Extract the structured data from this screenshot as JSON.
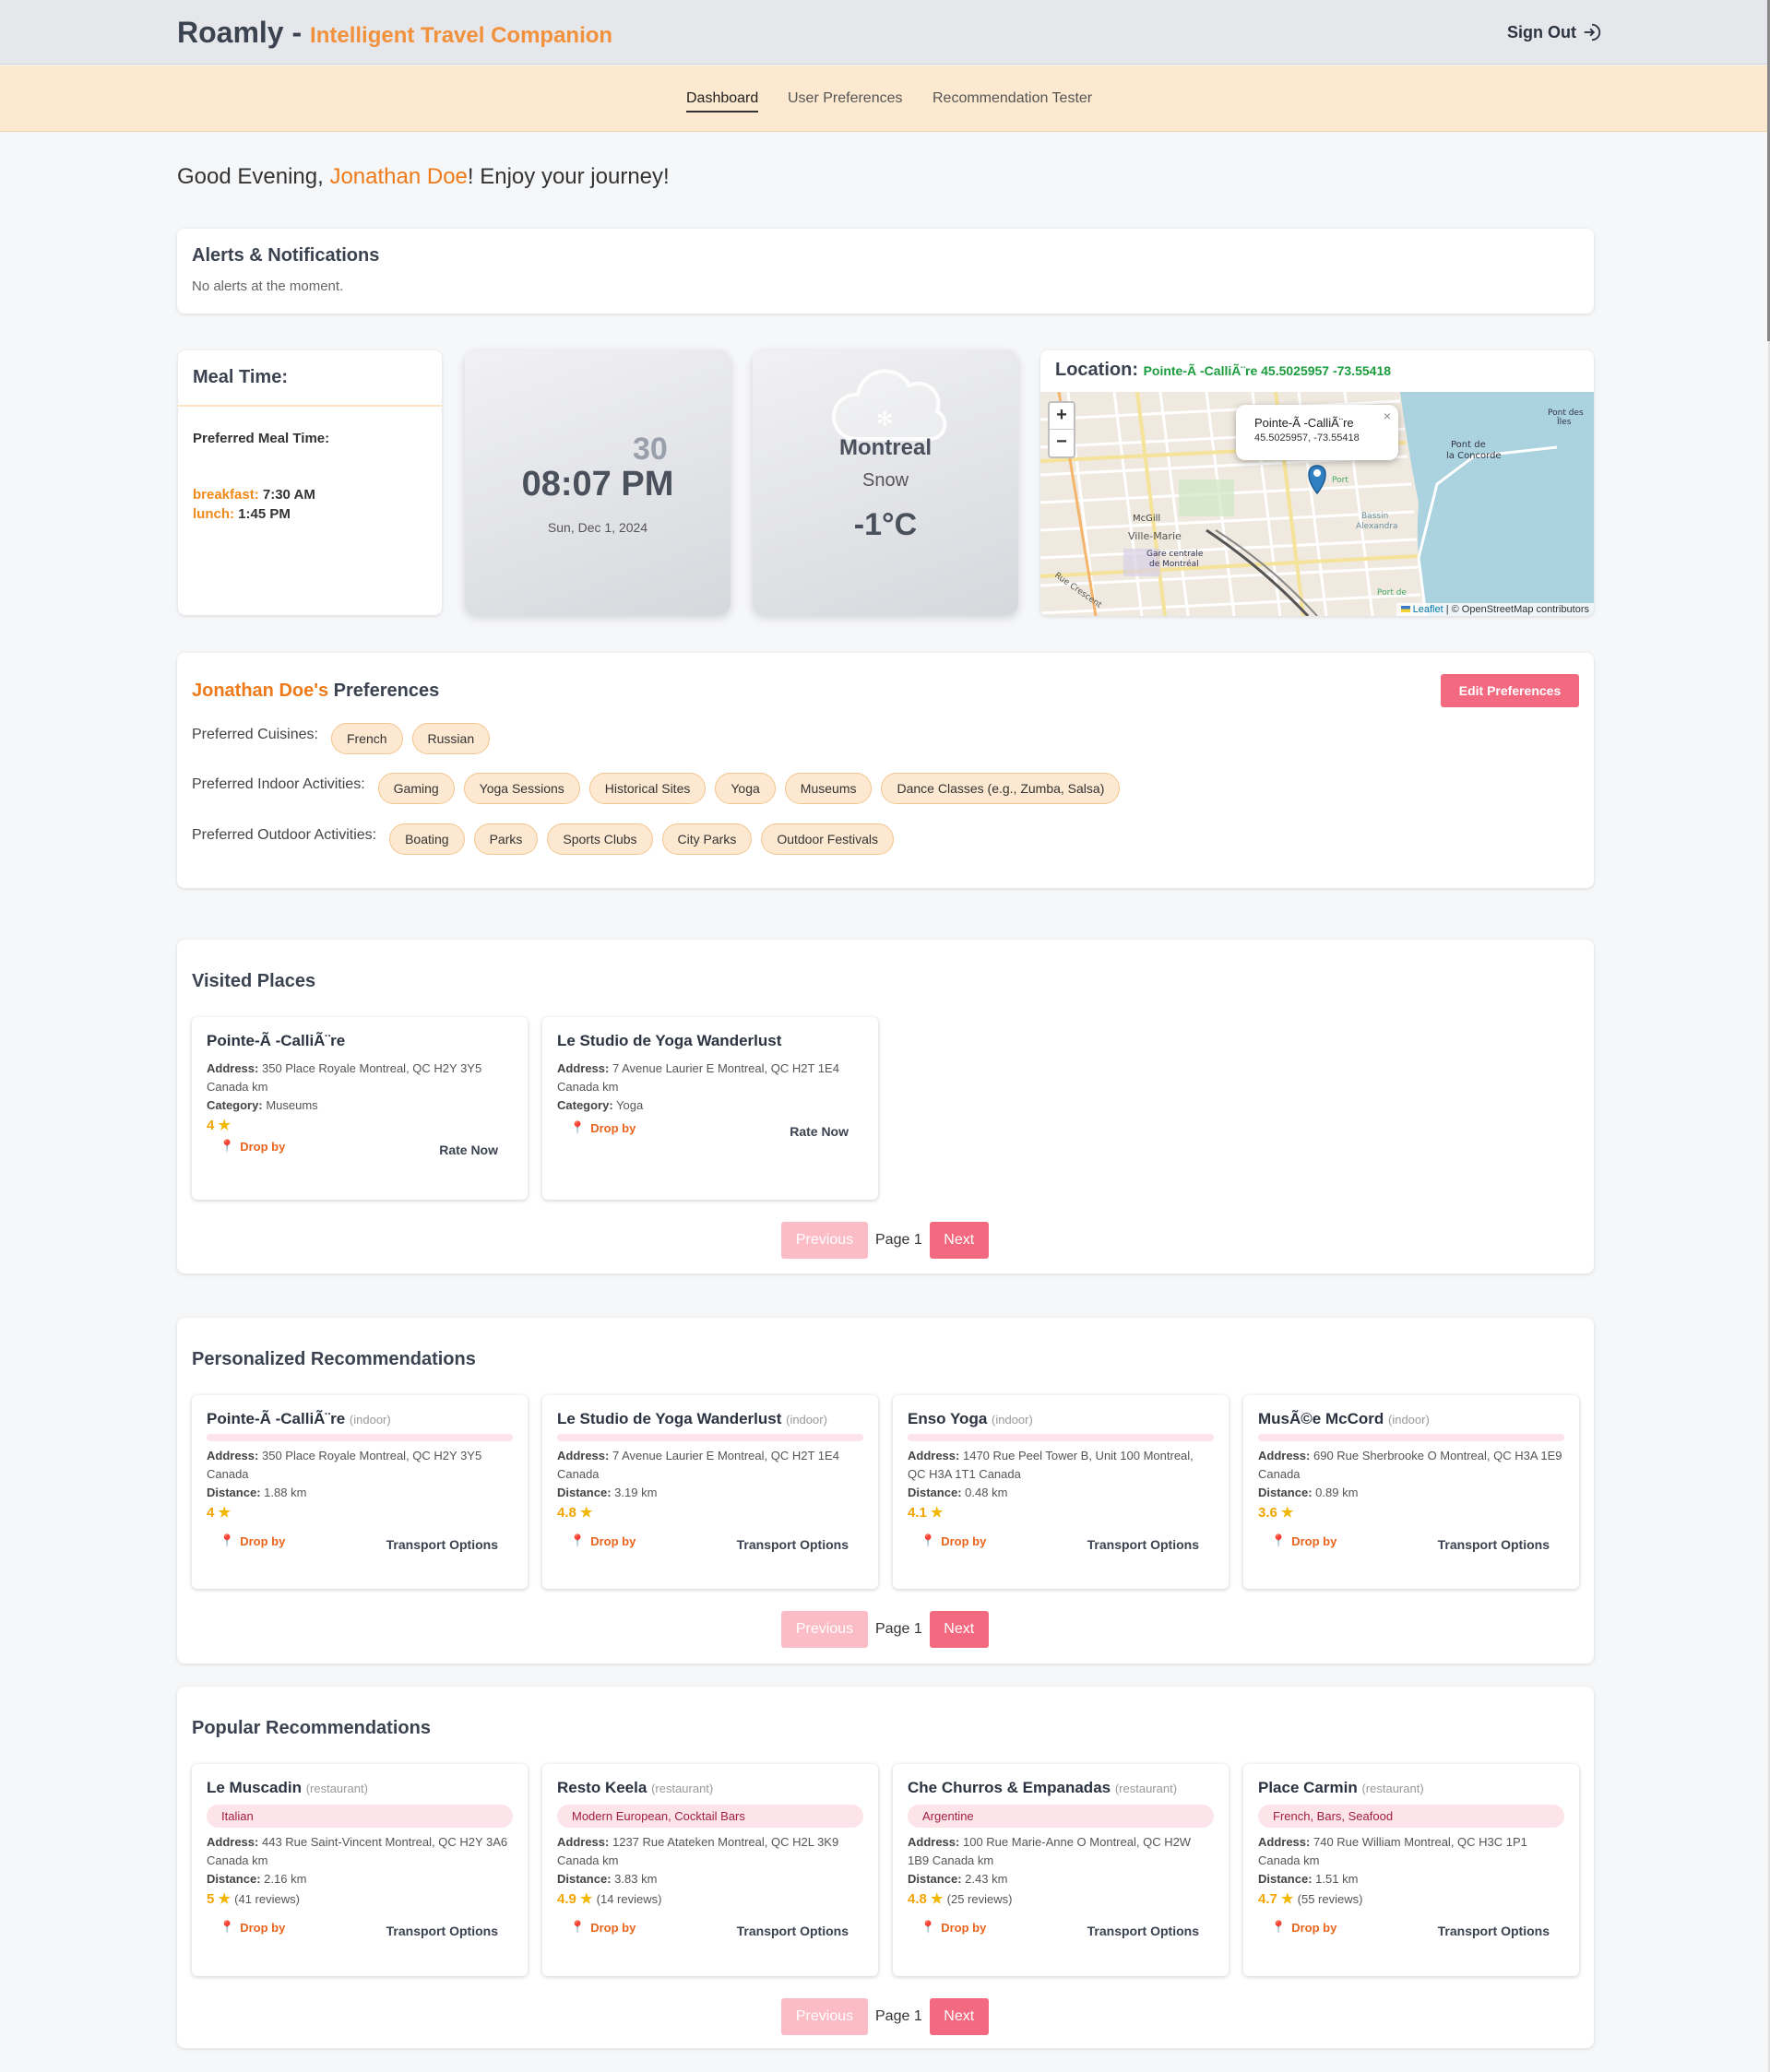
{
  "header": {
    "brand": "Roamly",
    "separator": "-",
    "tagline": "Intelligent Travel Companion",
    "signout": "Sign Out"
  },
  "nav": [
    {
      "label": "Dashboard",
      "active": true
    },
    {
      "label": "User Preferences",
      "active": false
    },
    {
      "label": "Recommendation Tester",
      "active": false
    }
  ],
  "greeting": {
    "prefix": "Good Evening, ",
    "name": "Jonathan Doe",
    "suffix": "! Enjoy your journey!"
  },
  "alerts": {
    "title": "Alerts & Notifications",
    "message": "No alerts at the moment."
  },
  "meal": {
    "title": "Meal Time:",
    "subtitle": "Preferred Meal Time:",
    "items": [
      {
        "key": "breakfast:",
        "value": "7:30 AM"
      },
      {
        "key": "lunch:",
        "value": "1:45 PM"
      }
    ]
  },
  "clock": {
    "seconds": "30",
    "time": "08:07 PM",
    "date": "Sun, Dec 1, 2024"
  },
  "weather": {
    "city": "Montreal",
    "condition": "Snow",
    "temp": "-1°C",
    "icon": "snow-cloud-icon"
  },
  "location": {
    "label": "Location:",
    "value": "Pointe-Ã -CalliÃ¨re 45.5025957 -73.55418",
    "popup_name": "Pointe-Ã -CalliÃ¨re",
    "popup_coords": "45.5025957, -73.55418",
    "zoom_in": "+",
    "zoom_out": "−",
    "attribution_leaflet": "Leaflet",
    "attribution_rest": "| © OpenStreetMap contributors",
    "map_labels": [
      "Gare centrale de Montréal",
      "Ville-Marie",
      "McGill",
      "Pont de la Concorde",
      "Port",
      "Bassin Alexandra",
      "Pont des Îles",
      "Rue Crescent",
      "Port de"
    ]
  },
  "preferences": {
    "name": "Jonathan Doe's",
    "title": " Preferences",
    "edit_button": "Edit Preferences",
    "cuisines_label": "Preferred Cuisines:",
    "cuisines": [
      "French",
      "Russian"
    ],
    "indoor_label": "Preferred Indoor Activities:",
    "indoor": [
      "Gaming",
      "Yoga Sessions",
      "Historical Sites",
      "Yoga",
      "Museums",
      "Dance Classes (e.g., Zumba, Salsa)"
    ],
    "outdoor_label": "Preferred Outdoor Activities:",
    "outdoor": [
      "Boating",
      "Parks",
      "Sports Clubs",
      "City Parks",
      "Outdoor Festivals"
    ]
  },
  "labels": {
    "address": "Address:",
    "category": "Category:",
    "distance": "Distance:",
    "drop_by": "Drop by",
    "rate_now": "Rate Now",
    "transport": "Transport Options",
    "previous": "Previous",
    "page": "Page 1",
    "next": "Next"
  },
  "visited": {
    "title": "Visited Places",
    "items": [
      {
        "name": "Pointe-Ã -CalliÃ¨re",
        "address": "350 Place Royale Montreal, QC H2Y 3Y5 Canada km",
        "category": "Museums",
        "rating": "4"
      },
      {
        "name": "Le Studio de Yoga Wanderlust",
        "address": "7 Avenue Laurier E Montreal, QC H2T 1E4 Canada km",
        "category": "Yoga",
        "rating": ""
      }
    ]
  },
  "personalized": {
    "title": "Personalized Recommendations",
    "items": [
      {
        "name": "Pointe-Ã -CalliÃ¨re",
        "type": "(indoor)",
        "address": "350 Place Royale Montreal, QC H2Y 3Y5 Canada",
        "distance": "1.88 km",
        "rating": "4"
      },
      {
        "name": "Le Studio de Yoga Wanderlust",
        "type": "(indoor)",
        "address": "7 Avenue Laurier E Montreal, QC H2T 1E4 Canada",
        "distance": "3.19 km",
        "rating": "4.8"
      },
      {
        "name": "Enso Yoga",
        "type": "(indoor)",
        "address": "1470 Rue Peel Tower B, Unit 100 Montreal, QC H3A 1T1 Canada",
        "distance": "0.48 km",
        "rating": "4.1"
      },
      {
        "name": "MusÃ©e McCord",
        "type": "(indoor)",
        "address": "690 Rue Sherbrooke O Montreal, QC H3A 1E9 Canada",
        "distance": "0.89 km",
        "rating": "3.6"
      }
    ]
  },
  "popular": {
    "title": "Popular Recommendations",
    "items": [
      {
        "name": "Le Muscadin",
        "type": "(restaurant)",
        "cuisine": "Italian",
        "address": "443 Rue Saint-Vincent Montreal, QC H2Y 3A6 Canada km",
        "distance": "2.16 km",
        "rating": "5",
        "reviews": "(41 reviews)"
      },
      {
        "name": "Resto Keela",
        "type": "(restaurant)",
        "cuisine": "Modern European, Cocktail Bars",
        "address": "1237 Rue Atateken Montreal, QC H2L 3K9 Canada km",
        "distance": "3.83 km",
        "rating": "4.9",
        "reviews": "(14 reviews)"
      },
      {
        "name": "Che Churros & Empanadas",
        "type": "(restaurant)",
        "cuisine": "Argentine",
        "address": "100 Rue Marie-Anne O Montreal, QC H2W 1B9 Canada km",
        "distance": "2.43 km",
        "rating": "4.8",
        "reviews": "(25 reviews)"
      },
      {
        "name": "Place Carmin",
        "type": "(restaurant)",
        "cuisine": "French, Bars, Seafood",
        "address": "740 Rue William Montreal, QC H3C 1P1 Canada km",
        "distance": "1.51 km",
        "rating": "4.7",
        "reviews": "(55 reviews)"
      }
    ]
  },
  "colors": {
    "accent": "#ef7a1a",
    "pink": "#f36a80",
    "chip": "#fde9d1",
    "nav": "#fde9cf"
  }
}
